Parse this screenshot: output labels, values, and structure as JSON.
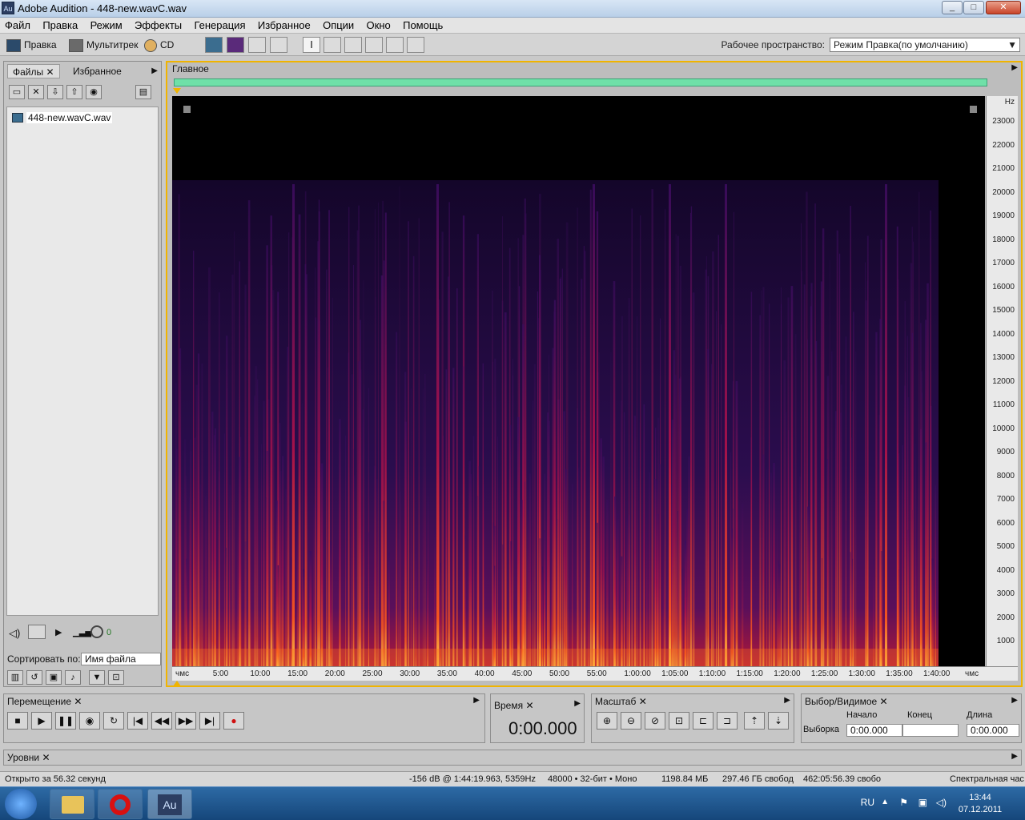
{
  "window": {
    "title": "Adobe Audition - 448-new.wavC.wav",
    "app_icon": "Au"
  },
  "menu": [
    "Файл",
    "Правка",
    "Режим",
    "Эффекты",
    "Генерация",
    "Избранное",
    "Опции",
    "Окно",
    "Помощь"
  ],
  "toolbar": {
    "edit_label": "Правка",
    "multitrack_label": "Мультитрек",
    "cd_label": "CD",
    "workspace_label": "Рабочее пространство:",
    "workspace_value": "Режим Правка(по умолчанию)"
  },
  "files_panel": {
    "tab_files": "Файлы",
    "tab_favorites": "Избранное",
    "file_name": "448-new.wavC.wav",
    "sort_label": "Сортировать по:",
    "sort_value": "Имя файла",
    "volume_value": "0"
  },
  "editor": {
    "tab_label": "Главное",
    "freq_unit": "Hz",
    "freq_labels": [
      "23000",
      "22000",
      "21000",
      "20000",
      "19000",
      "18000",
      "17000",
      "16000",
      "15000",
      "14000",
      "13000",
      "12000",
      "11000",
      "10000",
      "9000",
      "8000",
      "7000",
      "6000",
      "5000",
      "4000",
      "3000",
      "2000",
      "1000"
    ],
    "time_labels": [
      "чмс",
      "5:00",
      "10:00",
      "15:00",
      "20:00",
      "25:00",
      "30:00",
      "35:00",
      "40:00",
      "45:00",
      "50:00",
      "55:00",
      "1:00:00",
      "1:05:00",
      "1:10:00",
      "1:15:00",
      "1:20:00",
      "1:25:00",
      "1:30:00",
      "1:35:00",
      "1:40:00",
      "чмс"
    ]
  },
  "transport": {
    "title": "Перемещение"
  },
  "time_panel": {
    "title": "Время",
    "value": "0:00.000"
  },
  "zoom_panel": {
    "title": "Масштаб"
  },
  "selection_panel": {
    "title": "Выбор/Видимое",
    "col_start": "Начало",
    "col_end": "Конец",
    "col_length": "Длина",
    "row_label": "Выборка",
    "start": "0:00.000",
    "end": "",
    "length": "0:00.000"
  },
  "levels_panel": {
    "title": "Уровни"
  },
  "status": {
    "opened": "Открыто за 56.32 секунд",
    "cursor": "-156 dB @ 1:44:19.963, 5359Hz",
    "format": "48000 • 32-бит • Моно",
    "size": "1198.84 МБ",
    "free": "297.46 ГБ свобод",
    "free_time": "462:05:56.39 свобо",
    "view": "Спектральная час"
  },
  "taskbar": {
    "lang": "RU",
    "time": "13:44",
    "date": "07.12.2011",
    "app_au": "Au"
  }
}
